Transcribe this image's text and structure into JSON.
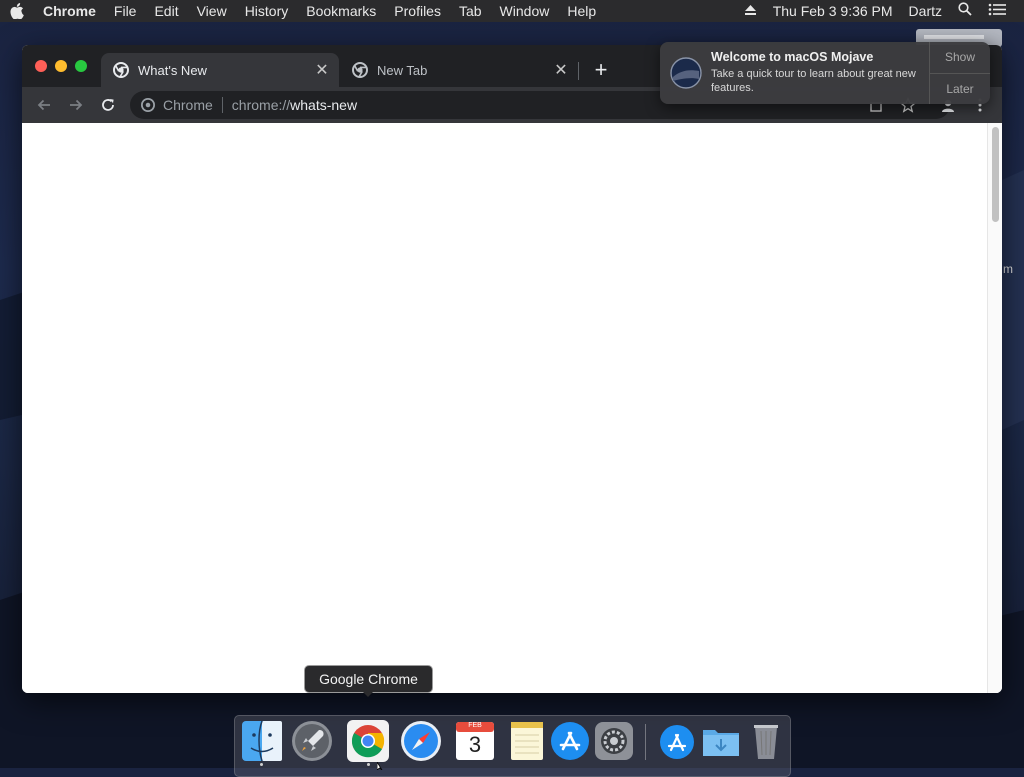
{
  "menubar": {
    "app_name": "Chrome",
    "items": [
      "File",
      "Edit",
      "View",
      "History",
      "Bookmarks",
      "Profiles",
      "Tab",
      "Window",
      "Help"
    ],
    "datetime": "Thu Feb 3  9:36 PM",
    "user": "Dartz"
  },
  "window": {
    "tabs": [
      {
        "title": "What's New",
        "active": true
      },
      {
        "title": "New Tab",
        "active": false
      }
    ],
    "omnibox": {
      "chip": "Chrome",
      "url_scheme": "chrome://",
      "url_host": "whats-new"
    }
  },
  "notification": {
    "title": "Welcome to macOS Mojave",
    "body": "Take a quick tour to learn about great new features.",
    "actions": [
      "Show",
      "Later"
    ]
  },
  "dock": {
    "tooltip": "Google Chrome",
    "items": [
      {
        "name": "Finder",
        "running": true
      },
      {
        "name": "Launchpad",
        "running": false
      },
      {
        "name": "Google Chrome",
        "running": true
      },
      {
        "name": "Safari",
        "running": false
      },
      {
        "name": "Calendar",
        "running": false,
        "month": "FEB",
        "day": "3"
      },
      {
        "name": "Notes",
        "running": false
      },
      {
        "name": "App Store",
        "running": false
      },
      {
        "name": "System Preferences",
        "running": false
      },
      {
        "name": "Applications",
        "running": false
      },
      {
        "name": "Downloads",
        "running": false
      },
      {
        "name": "Trash",
        "running": false
      }
    ]
  },
  "desktop": {
    "glimpse_text": "m"
  },
  "colors": {
    "menubar_bg": "#2b2b2d",
    "tabstrip_bg": "#202124",
    "active_tab_bg": "#35363a",
    "close": "#fe5f57",
    "minimize": "#febc2e",
    "maximize": "#28c840"
  }
}
